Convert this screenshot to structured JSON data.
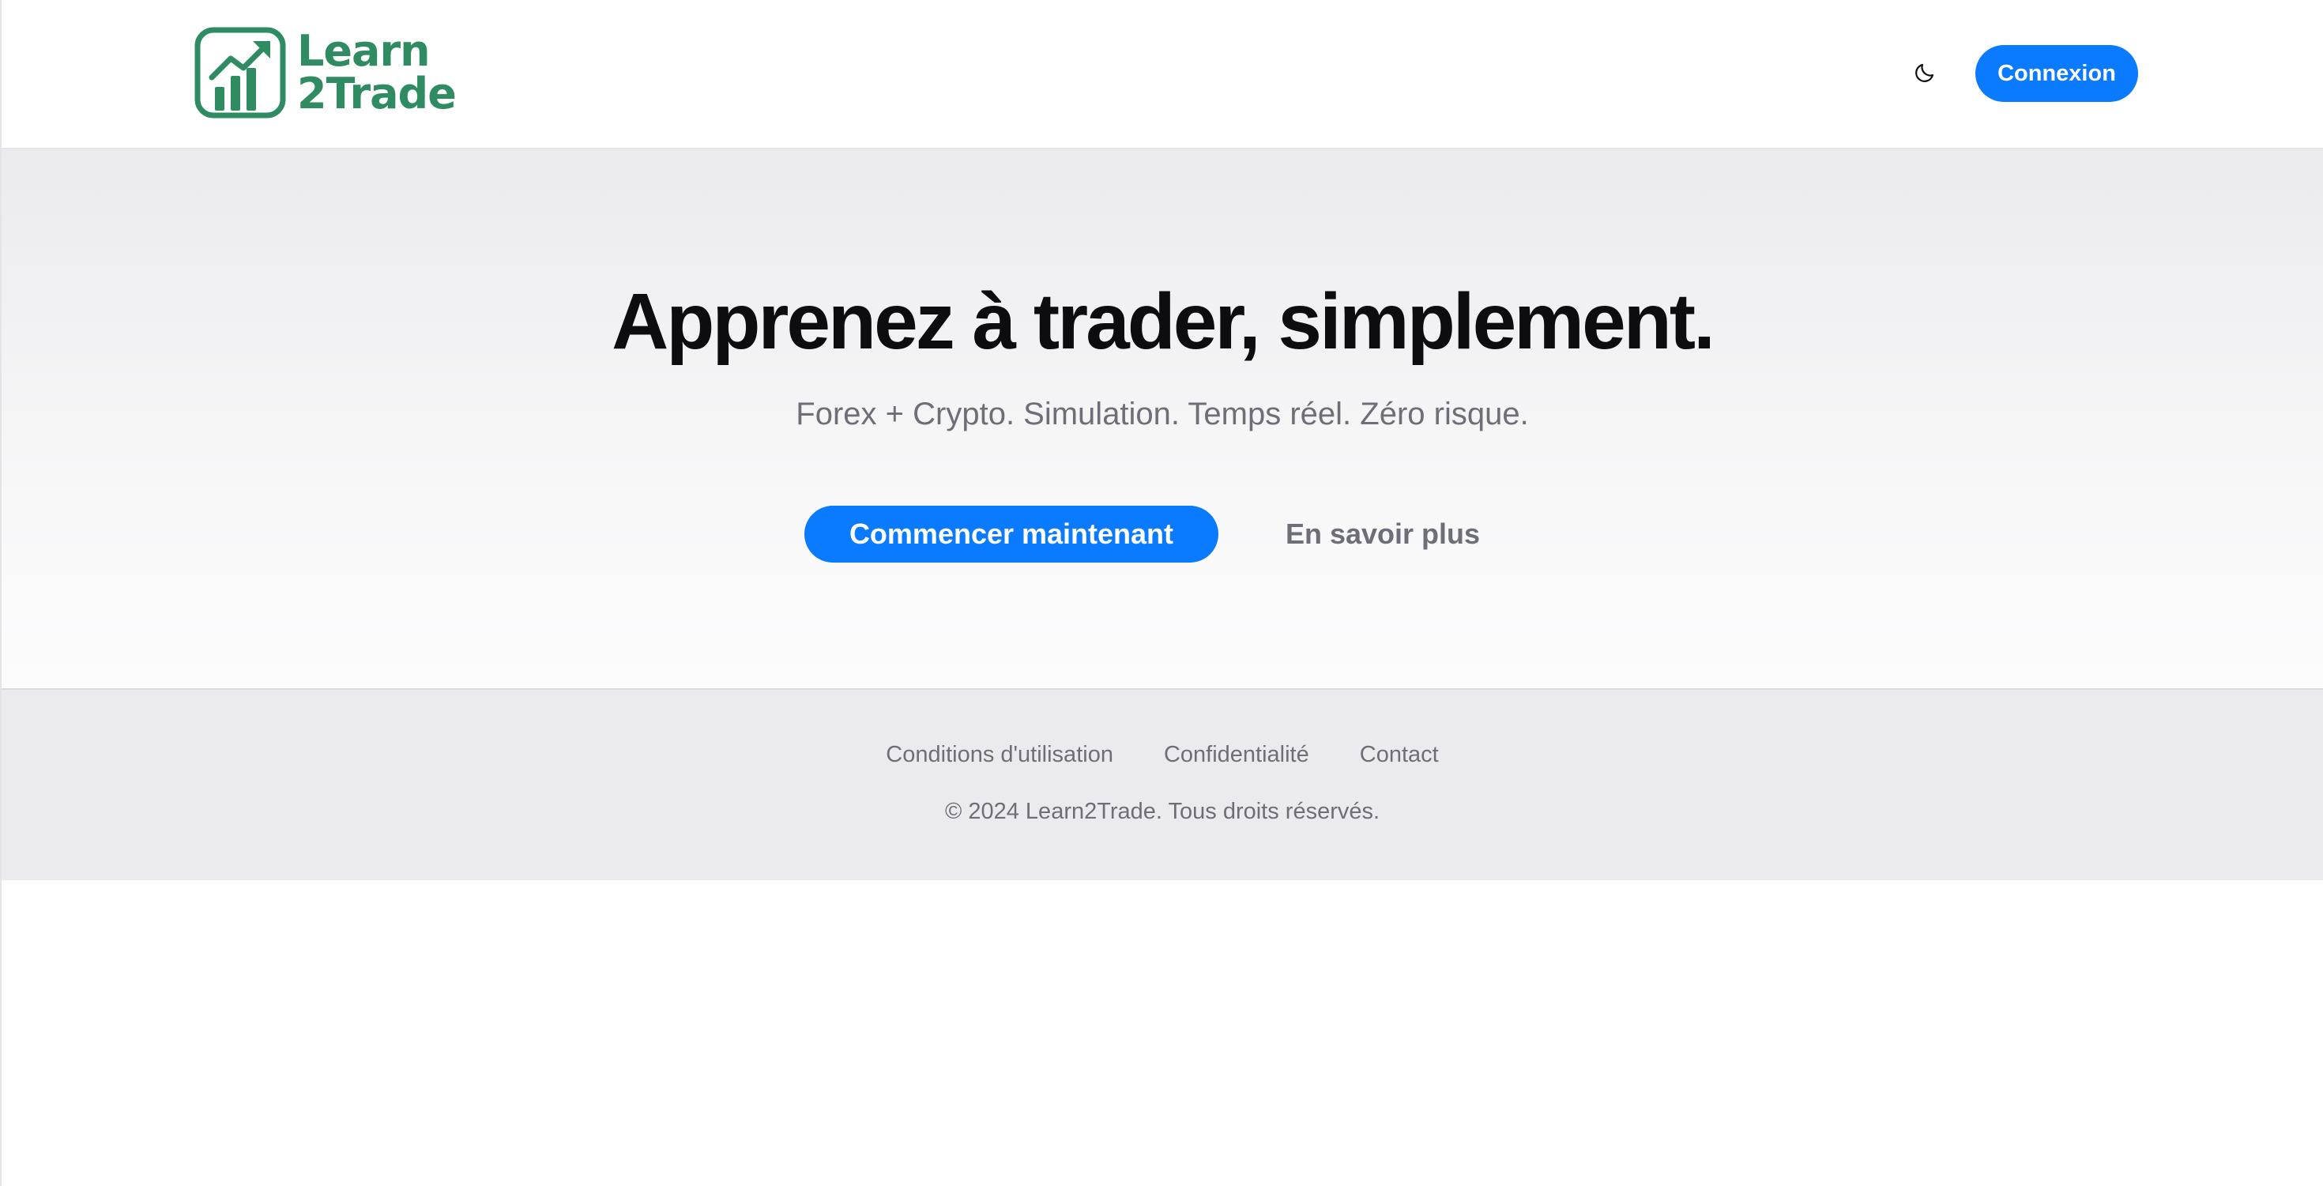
{
  "header": {
    "logo": {
      "line1": "Learn",
      "line2": "2Trade",
      "icon": "rising-chart-icon",
      "color": "#2e8b62"
    },
    "theme_toggle_icon": "moon-icon",
    "login_label": "Connexion"
  },
  "hero": {
    "title": "Apprenez à trader, simplement.",
    "subtitle": "Forex + Crypto. Simulation. Temps réel. Zéro risque.",
    "primary_cta": "Commencer maintenant",
    "secondary_cta": "En savoir plus"
  },
  "footer": {
    "links": [
      {
        "label": "Conditions d'utilisation"
      },
      {
        "label": "Confidentialité"
      },
      {
        "label": "Contact"
      }
    ],
    "copyright": "© 2024 Learn2Trade. Tous droits réservés."
  },
  "colors": {
    "accent": "#0a7aff",
    "brand": "#2e8b62",
    "muted_text": "#6e6e78",
    "footer_bg": "#ebebef"
  }
}
